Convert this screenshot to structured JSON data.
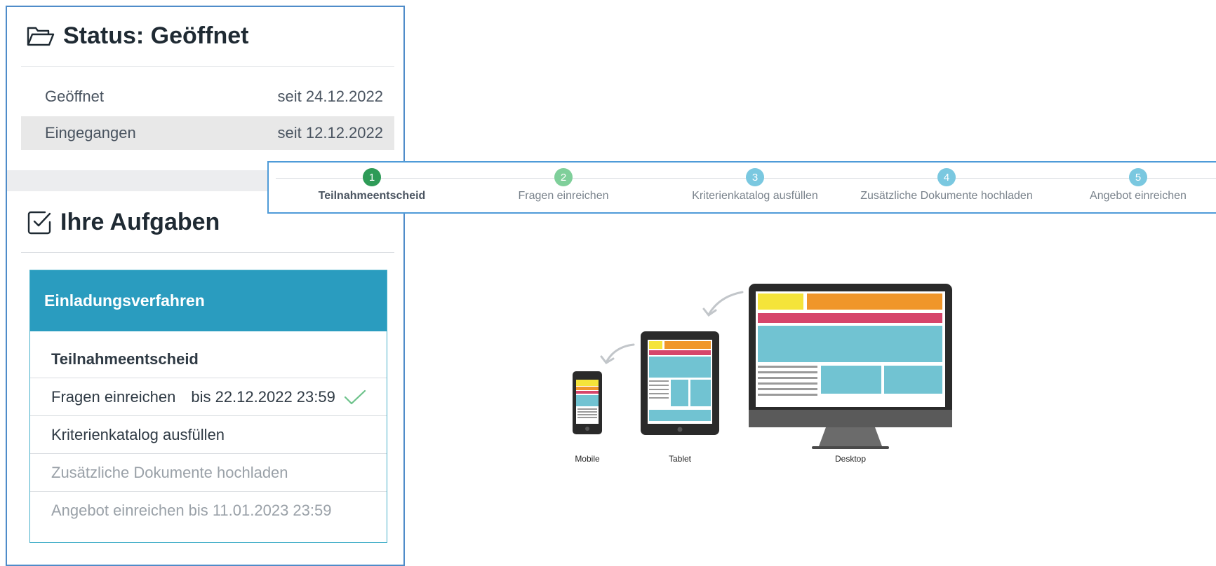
{
  "status": {
    "title": "Status: Geöffnet",
    "icon": "folder-open-icon",
    "rows": [
      {
        "label": "Geöffnet",
        "value": "seit 24.12.2022"
      },
      {
        "label": "Eingegangen",
        "value": "seit 12.12.2022"
      }
    ]
  },
  "tasks": {
    "title": "Ihre Aufgaben",
    "icon": "checkbox-checked-icon",
    "procedure": {
      "title": "Einladungsverfahren",
      "items": [
        {
          "label": "Teilnahmeentscheid",
          "due": ""
        },
        {
          "label": "Fragen einreichen",
          "due": "bis 22.12.2022 23:59",
          "done_icon": "checkmark-icon"
        },
        {
          "label": "Kriterienkatalog ausfüllen",
          "due": ""
        },
        {
          "label": "Zusätzliche Dokumente hochladen",
          "due": ""
        },
        {
          "label": "Angebot einreichen",
          "due": "bis 11.01.2023 23:59"
        }
      ]
    }
  },
  "stepper": {
    "steps": [
      {
        "number": "1",
        "label": "Teilnahmeentscheid",
        "color": "#2e9b57"
      },
      {
        "number": "2",
        "label": "Fragen einreichen",
        "color": "#7fcf9a"
      },
      {
        "number": "3",
        "label": "Kriterienkatalog ausfüllen",
        "color": "#7ac8e0"
      },
      {
        "number": "4",
        "label": "Zusätzliche Dokumente hochladen",
        "color": "#7ac8e0"
      },
      {
        "number": "5",
        "label": "Angebot einreichen",
        "color": "#7ac8e0"
      }
    ]
  },
  "illustration": {
    "devices": [
      {
        "label": "Mobile"
      },
      {
        "label": "Tablet"
      },
      {
        "label": "Desktop"
      }
    ]
  },
  "colors": {
    "accent": "#2a9cbf",
    "border": "#4f8cc9",
    "check": "#6cc28a"
  }
}
